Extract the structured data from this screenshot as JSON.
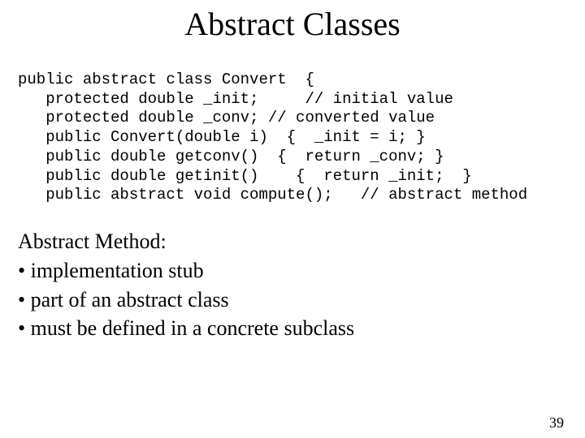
{
  "title": "Abstract Classes",
  "code": {
    "l1": "public abstract class Convert  {",
    "l2": "   protected double _init;     // initial value",
    "l3": "   protected double _conv; // converted value",
    "l4": "   public Convert(double i)  {  _init = i; }",
    "l5": "   public double getconv()  {  return _conv; }",
    "l6": "   public double getinit()    {  return _init;  }",
    "l7": "   public abstract void compute();   // abstract method"
  },
  "body": {
    "heading": "Abstract Method:",
    "b1": "• implementation stub",
    "b2": "• part of an abstract class",
    "b3": "• must be defined in a concrete subclass"
  },
  "page": "39"
}
